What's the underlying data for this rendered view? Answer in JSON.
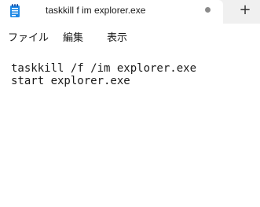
{
  "tab": {
    "icon": "notepad-icon",
    "title": "taskkill f im explorer.exe",
    "unsaved_indicator": "modified-dot-icon",
    "new_tab_label": "+"
  },
  "menu": {
    "file": "ファイル",
    "edit": "編集",
    "view": "表示"
  },
  "editor": {
    "lines": [
      "taskkill /f /im explorer.exe",
      "start explorer.exe"
    ]
  },
  "colors": {
    "tabbar_bg": "#f0f0f0",
    "active_tab_bg": "#ffffff",
    "text": "#1a1a1a",
    "icon_blue": "#1e88e5"
  }
}
